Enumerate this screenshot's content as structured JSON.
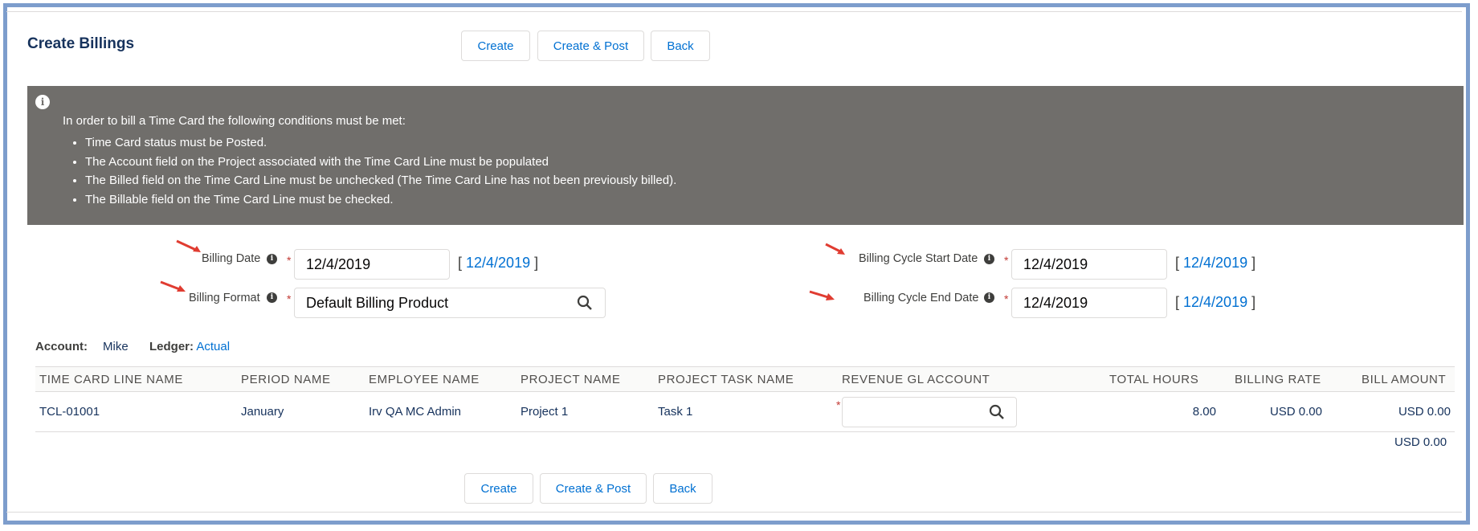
{
  "page": {
    "title": "Create Billings"
  },
  "buttons": {
    "create": "Create",
    "create_post": "Create & Post",
    "back": "Back"
  },
  "info": {
    "intro": "In order to bill a Time Card the following conditions must be met:",
    "items": [
      "Time Card status must be Posted.",
      "The Account field on the Project associated with the Time Card Line must be populated",
      "The Billed field on the Time Card Line must be unchecked (The Time Card Line has not been previously billed).",
      "The Billable field on the Time Card Line must be checked."
    ]
  },
  "form": {
    "billing_date": {
      "label": "Billing Date",
      "value": "12/4/2019",
      "today_link": "12/4/2019"
    },
    "billing_format": {
      "label": "Billing Format",
      "value": "Default Billing Product"
    },
    "cycle_start": {
      "label": "Billing Cycle Start Date",
      "value": "12/4/2019",
      "today_link": "12/4/2019"
    },
    "cycle_end": {
      "label": "Billing Cycle End Date",
      "value": "12/4/2019",
      "today_link": "12/4/2019"
    }
  },
  "meta": {
    "account_label": "Account:",
    "account_value": "Mike",
    "ledger_label": "Ledger:",
    "ledger_value": "Actual"
  },
  "table": {
    "headers": [
      "TIME CARD LINE NAME",
      "PERIOD NAME",
      "EMPLOYEE NAME",
      "PROJECT NAME",
      "PROJECT TASK NAME",
      "REVENUE GL ACCOUNT",
      "TOTAL HOURS",
      "BILLING RATE",
      "BILL AMOUNT"
    ],
    "rows": [
      [
        "TCL-01001",
        "January",
        "Irv QA MC Admin",
        "Project 1",
        "Task 1",
        "",
        "8.00",
        "USD 0.00",
        "USD 0.00"
      ]
    ],
    "total": "USD 0.00"
  },
  "colors": {
    "accent": "#0070d2",
    "panel": "#706e6b",
    "required": "#c23934",
    "arrow": "#e03c31"
  },
  "icons": [
    "info-icon",
    "help-icon",
    "search-icon",
    "arrow-icon"
  ]
}
